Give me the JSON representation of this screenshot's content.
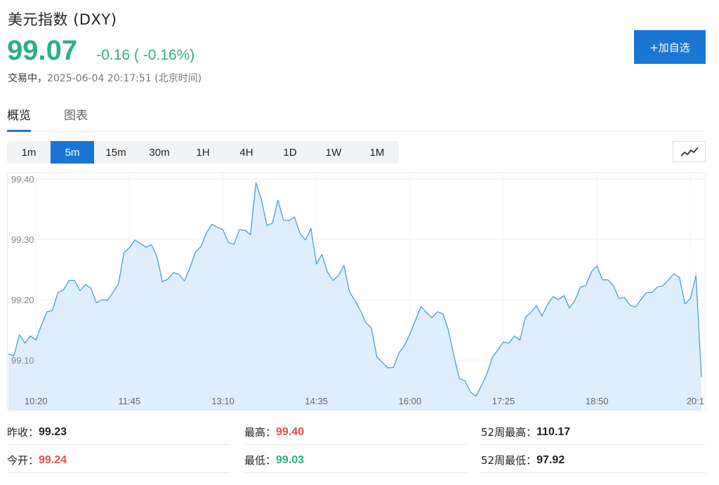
{
  "header": {
    "title": "美元指数",
    "symbol": "(DXY)",
    "price": "99.07",
    "change": "-0.16 ( -0.16%)",
    "status": "交易中，",
    "timestamp": "2025-06-04 20:17:51 (北京时间)",
    "add_button": "+加自选"
  },
  "colors": {
    "accent": "#1976d2",
    "down": "#2bb07f",
    "up": "#e84c4c",
    "line": "#3c96dc",
    "fill": "#deeefc"
  },
  "tabs": [
    {
      "label": "概览",
      "active": true
    },
    {
      "label": "图表",
      "active": false
    }
  ],
  "periods": [
    {
      "label": "1m",
      "active": false
    },
    {
      "label": "5m",
      "active": true
    },
    {
      "label": "15m",
      "active": false
    },
    {
      "label": "30m",
      "active": false
    },
    {
      "label": "1H",
      "active": false
    },
    {
      "label": "4H",
      "active": false
    },
    {
      "label": "1D",
      "active": false
    },
    {
      "label": "1W",
      "active": false
    },
    {
      "label": "1M",
      "active": false
    }
  ],
  "chart_type_icon": "line-chart-icon",
  "chart_data": {
    "type": "area",
    "title": "",
    "xlabel": "",
    "ylabel": "",
    "ylim": [
      99.03,
      99.41
    ],
    "y_ticks": [
      "99.10",
      "99.20",
      "99.30",
      "99.40"
    ],
    "x_ticks": [
      "10:20",
      "11:45",
      "13:10",
      "14:35",
      "16:00",
      "17:25",
      "18:50",
      "20:1"
    ],
    "grid": true,
    "legend": "none",
    "x": [
      "09:55",
      "10:00",
      "10:05",
      "10:10",
      "10:15",
      "10:20",
      "10:25",
      "10:30",
      "10:35",
      "10:40",
      "10:45",
      "10:50",
      "10:55",
      "11:00",
      "11:05",
      "11:10",
      "11:15",
      "11:20",
      "11:25",
      "11:30",
      "11:35",
      "11:40",
      "11:45",
      "11:50",
      "11:55",
      "12:00",
      "12:05",
      "12:10",
      "12:15",
      "12:20",
      "12:25",
      "12:30",
      "12:35",
      "12:40",
      "12:45",
      "12:50",
      "12:55",
      "13:00",
      "13:05",
      "13:10",
      "13:15",
      "13:20",
      "13:25",
      "13:30",
      "13:35",
      "13:40",
      "13:45",
      "13:50",
      "13:55",
      "14:00",
      "14:05",
      "14:10",
      "14:15",
      "14:20",
      "14:25",
      "14:30",
      "14:35",
      "14:40",
      "14:45",
      "14:50",
      "14:55",
      "15:00",
      "15:05",
      "15:10",
      "15:15",
      "15:20",
      "15:25",
      "15:30",
      "15:35",
      "15:40",
      "15:45",
      "15:50",
      "15:55",
      "16:00",
      "16:05",
      "16:10",
      "16:15",
      "16:20",
      "16:25",
      "16:30",
      "16:35",
      "16:40",
      "16:45",
      "16:50",
      "16:55",
      "17:00",
      "17:05",
      "17:10",
      "17:15",
      "17:20",
      "17:25",
      "17:30",
      "17:35",
      "17:40",
      "17:45",
      "17:50",
      "17:55",
      "18:00",
      "18:05",
      "18:10",
      "18:15",
      "18:20",
      "18:25",
      "18:30",
      "18:35",
      "18:40",
      "18:45",
      "18:50",
      "18:55",
      "19:00",
      "19:05",
      "19:10",
      "19:15",
      "19:20",
      "19:25",
      "19:30",
      "19:35",
      "19:40",
      "19:45",
      "19:50",
      "19:55",
      "20:00",
      "20:05",
      "20:10",
      "20:15"
    ],
    "values": [
      99.11,
      99.107,
      99.142,
      99.128,
      99.14,
      99.133,
      99.158,
      99.18,
      99.182,
      99.212,
      99.216,
      99.232,
      99.232,
      99.215,
      99.225,
      99.219,
      99.195,
      99.2,
      99.199,
      99.212,
      99.226,
      99.278,
      99.286,
      99.299,
      99.293,
      99.287,
      99.291,
      99.272,
      99.23,
      99.234,
      99.245,
      99.242,
      99.231,
      99.253,
      99.279,
      99.288,
      99.311,
      99.325,
      99.32,
      99.316,
      99.295,
      99.292,
      99.316,
      99.315,
      99.308,
      99.394,
      99.366,
      99.323,
      99.327,
      99.365,
      99.332,
      99.331,
      99.337,
      99.31,
      99.299,
      99.318,
      99.259,
      99.275,
      99.246,
      99.232,
      99.24,
      99.257,
      99.213,
      99.199,
      99.182,
      99.162,
      99.153,
      99.105,
      99.096,
      99.087,
      99.088,
      99.112,
      99.124,
      99.143,
      99.166,
      99.189,
      99.179,
      99.17,
      99.18,
      99.177,
      99.149,
      99.107,
      99.069,
      99.066,
      99.047,
      99.04,
      99.058,
      99.077,
      99.105,
      99.117,
      99.13,
      99.128,
      99.14,
      99.133,
      99.171,
      99.179,
      99.19,
      99.173,
      99.192,
      99.205,
      99.2,
      99.207,
      99.186,
      99.199,
      99.221,
      99.224,
      99.246,
      99.256,
      99.233,
      99.233,
      99.223,
      99.202,
      99.204,
      99.191,
      99.188,
      99.2,
      99.212,
      99.212,
      99.221,
      99.223,
      99.233,
      99.243,
      99.237,
      99.193,
      99.202,
      99.24,
      99.072
    ]
  },
  "stats": [
    {
      "label": "昨收：",
      "value": "99.23",
      "tone": "flat"
    },
    {
      "label": "最高：",
      "value": "99.40",
      "tone": "up"
    },
    {
      "label": "52周最高：",
      "value": "110.17",
      "tone": "flat"
    },
    {
      "label": "今开：",
      "value": "99.24",
      "tone": "up"
    },
    {
      "label": "最低：",
      "value": "99.03",
      "tone": "down"
    },
    {
      "label": "52周最低：",
      "value": "97.92",
      "tone": "flat"
    }
  ]
}
